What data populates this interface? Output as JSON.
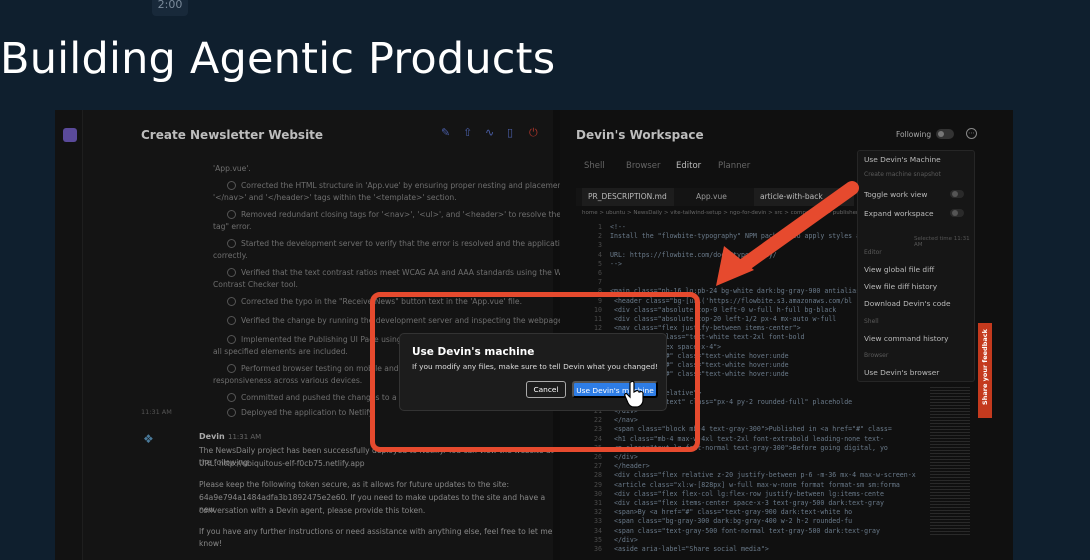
{
  "slide": {
    "time": "2:00",
    "title": "Building Agentic Products"
  },
  "chat": {
    "title": "Create Newsletter Website",
    "steps": [
      "'App.vue'.",
      "Corrected the HTML structure in 'App.vue' by ensuring proper nesting and placement of the",
      "Removed redundant closing tags for '<nav>', '<ul>', and '<header>' to resolve the \"invalid end",
      "Started the development server to verify that the error is resolved and the application renders",
      "Verified that the text contrast ratios meet WCAG AA and AAA standards using the WebAIM",
      "Corrected the typo in the \"Receive News\" button text in the 'App.vue' file.",
      "Verified the change by running the development server and inspecting the webpage.",
      "Implemented the Publishing UI Page using 'article-with-background'",
      "Performed browser testing on mobile and tablet emulators to",
      "Committed and pushed the changes to a new branch feature",
      "Deployed the application to Netlify."
    ],
    "continuations": [
      "'</nav>' and '</header>' tags within the '<template>' section.",
      "tag\" error.",
      "correctly.",
      "Contrast Checker tool.",
      "all specified elements are included.",
      "responsiveness across various devices."
    ],
    "time_label": "11:31 AM",
    "devin": {
      "name": "Devin",
      "time": "11:31 AM",
      "lines": [
        "The NewsDaily project has been successfully deployed to Netlify. You can view the website at the following",
        "URL: http://ubiquitous-elf-f0cb75.netlify.app",
        "Please keep the following token secure, as it allows for future updates to the site:",
        "64a9e794a1484adfa3b1892475e2e60. If you need to make updates to the site and have a new",
        "conversation with a Devin agent, please provide this token.",
        "If you have any further instructions or need assistance with anything else, feel free to let me know!"
      ]
    }
  },
  "workspace": {
    "title": "Devin's Workspace",
    "following": "Following",
    "tabs": [
      "Shell",
      "Browser",
      "Editor",
      "Planner"
    ],
    "active_tab": "Editor",
    "files": [
      "PR_DESCRIPTION.md",
      "App.vue",
      "article-with-back"
    ],
    "breadcrumb": "home > ubuntu > NewsDaily > vite-tailwind-setup > ngo-for-devin > src > components > publisher-sizes",
    "code": [
      {
        "ln": "1",
        "tx": "<!--"
      },
      {
        "ln": "2",
        "tx": "Install the \"flowbite-typography\" NPM package to apply styles and"
      },
      {
        "ln": "3",
        "tx": ""
      },
      {
        "ln": "4",
        "tx": "URL: https://flowbite.com/docs/typography/"
      },
      {
        "ln": "5",
        "tx": "-->"
      },
      {
        "ln": "6",
        "tx": ""
      },
      {
        "ln": "7",
        "tx": ""
      },
      {
        "ln": "8",
        "tx": "<main class=\"pb-16 lg:pb-24 bg-white dark:bg-gray-900 antialiase"
      },
      {
        "ln": "9",
        "tx": "  <header class=\"bg-[url('https://flowbite.s3.amazonaws.com/bl"
      },
      {
        "ln": "10",
        "tx": "    <div class=\"absolute top-0 left-0 w-full h-full bg-black"
      },
      {
        "ln": "11",
        "tx": "    <div class=\"absolute top-20 left-1/2 px-4 mx-auto w-full"
      },
      {
        "ln": "12",
        "tx": "      <nav class=\"flex justify-between items-center\">"
      },
      {
        "ln": "13",
        "tx": "        <a href=\"#\" class=\"text-white text-2xl font-bold"
      },
      {
        "ln": "14",
        "tx": "        <ul class=\"flex space-x-4\">"
      },
      {
        "ln": "15",
        "tx": "          <li><a href=\"#\" class=\"text-white hover:unde"
      },
      {
        "ln": "16",
        "tx": "          <li><a href=\"#\" class=\"text-white hover:unde"
      },
      {
        "ln": "17",
        "tx": "          <li><a href=\"#\" class=\"text-white hover:unde"
      },
      {
        "ln": "18",
        "tx": "        </ul>"
      },
      {
        "ln": "19",
        "tx": "        <div class=\"relative\">"
      },
      {
        "ln": "20",
        "tx": "          <input type=\"text\" class=\"px-4 py-2 rounded-full\" placeholde"
      },
      {
        "ln": "21",
        "tx": "        </div>"
      },
      {
        "ln": "22",
        "tx": "      </nav>"
      },
      {
        "ln": "23",
        "tx": "      <span class=\"block mb-4 text-gray-300\">Published in <a href=\"#\" class="
      },
      {
        "ln": "24",
        "tx": "      <h1 class=\"mb-4 max-w-4xl text-2xl font-extrabold leading-none text-"
      },
      {
        "ln": "25",
        "tx": "      <p class=\"text-lg font-normal text-gray-300\">Before going digital, yo"
      },
      {
        "ln": "26",
        "tx": "    </div>"
      },
      {
        "ln": "27",
        "tx": "  </header>"
      },
      {
        "ln": "28",
        "tx": "  <div class=\"flex relative z-20 justify-between p-6 -m-36 mx-4 max-w-screen-x"
      },
      {
        "ln": "29",
        "tx": "    <article class=\"xl:w-[828px] w-full max-w-none format format-sm sm:forma"
      },
      {
        "ln": "30",
        "tx": "      <div class=\"flex flex-col lg:flex-row justify-between lg:items-cente"
      },
      {
        "ln": "31",
        "tx": "        <div class=\"flex items-center space-x-3 text-gray-500 dark:text-gray"
      },
      {
        "ln": "32",
        "tx": "          <span>By <a href=\"#\" class=\"text-gray-900 dark:text-white ho"
      },
      {
        "ln": "33",
        "tx": "          <span class=\"bg-gray-300 dark:bg-gray-400 w-2 h-2 rounded-fu"
      },
      {
        "ln": "34",
        "tx": "          <span class=\"text-gray-500 font-normal text-gray-500 dark:text-gray"
      },
      {
        "ln": "35",
        "tx": "        </div>"
      },
      {
        "ln": "36",
        "tx": "        <aside aria-label=\"Share social media\">"
      }
    ]
  },
  "menu": {
    "items": [
      "Use Devin's Machine",
      "Create machine snapshot",
      "Toggle work view",
      "Expand workspace",
      "Editor",
      "View global file diff",
      "View file diff history",
      "Download Devin's code",
      "Shell",
      "View command history",
      "Browser",
      "Use Devin's browser"
    ],
    "timestamp": "Selected time 11:31 AM"
  },
  "feedback": "Share your feedback",
  "modal": {
    "title": "Use Devin's machine",
    "text": "If you modify any files, make sure to tell Devin what you changed!",
    "cancel": "Cancel",
    "confirm": "Use Devin's machine"
  },
  "colors": {
    "highlight": "#e64a2e",
    "primary_button": "#2e7de6",
    "slide_bg": "#0f1f2e"
  }
}
